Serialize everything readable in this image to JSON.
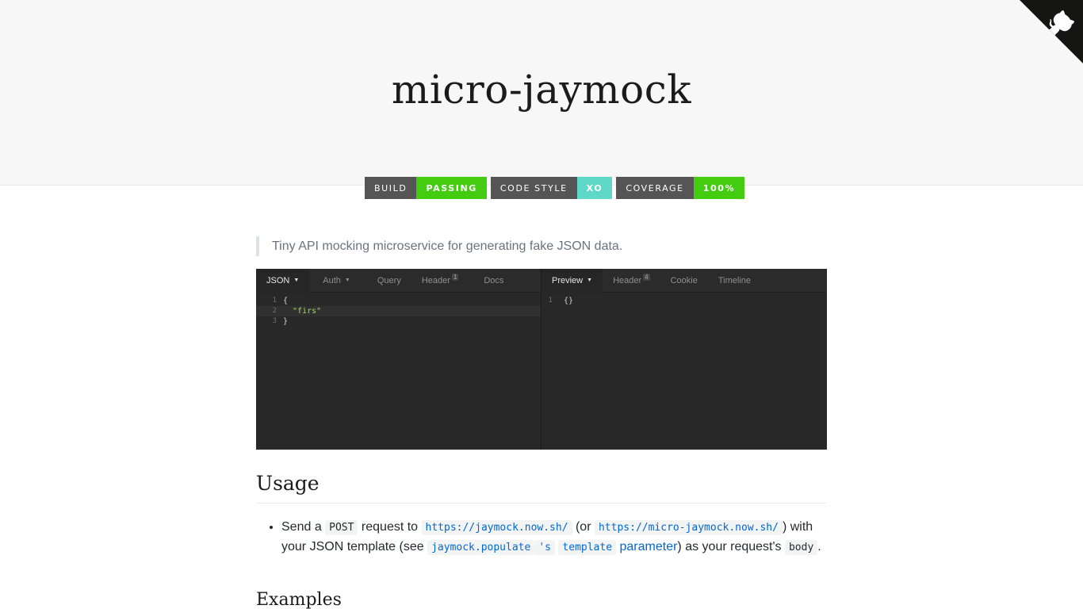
{
  "page": {
    "title": "micro-jaymock"
  },
  "badges": [
    {
      "key": "build",
      "value": "passing",
      "color": "#4c1"
    },
    {
      "key": "code style",
      "value": "xo",
      "color": "#5ed9c7"
    },
    {
      "key": "coverage",
      "value": "100%",
      "color": "#4c1"
    }
  ],
  "description": "Tiny API mocking microservice for generating fake JSON data.",
  "editor": {
    "left_tabs": [
      {
        "label": "JSON",
        "caret": "▼"
      },
      {
        "label": "Auth",
        "caret": "▼"
      },
      {
        "label": "Query"
      },
      {
        "label": "Header",
        "count": "1"
      },
      {
        "label": "Docs"
      }
    ],
    "right_tabs": [
      {
        "label": "Preview",
        "caret": "▼"
      },
      {
        "label": "Header",
        "count": "4"
      },
      {
        "label": "Cookie"
      },
      {
        "label": "Timeline"
      }
    ],
    "left_lines": [
      {
        "num": "1",
        "text": "{"
      },
      {
        "num": "2",
        "text": "  \"firs\""
      },
      {
        "num": "3",
        "text": "}"
      }
    ],
    "right_lines": [
      {
        "num": "1",
        "text": "{}"
      }
    ]
  },
  "usage": {
    "heading": "Usage",
    "item": {
      "t1": "Send a ",
      "code_post": "POST",
      "t2": " request to ",
      "link1": "https://jaymock.now.sh/",
      "t3": " (or ",
      "link2": "https://micro-jaymock.now.sh/",
      "t4": ") with your JSON template (see ",
      "link3a": "jaymock.populate",
      "link3b": "'s",
      "link3c": "template",
      "link3d": " parameter",
      "t5": ") as your request's ",
      "code_body": "body",
      "t6": "."
    }
  },
  "examples_heading": "Examples"
}
